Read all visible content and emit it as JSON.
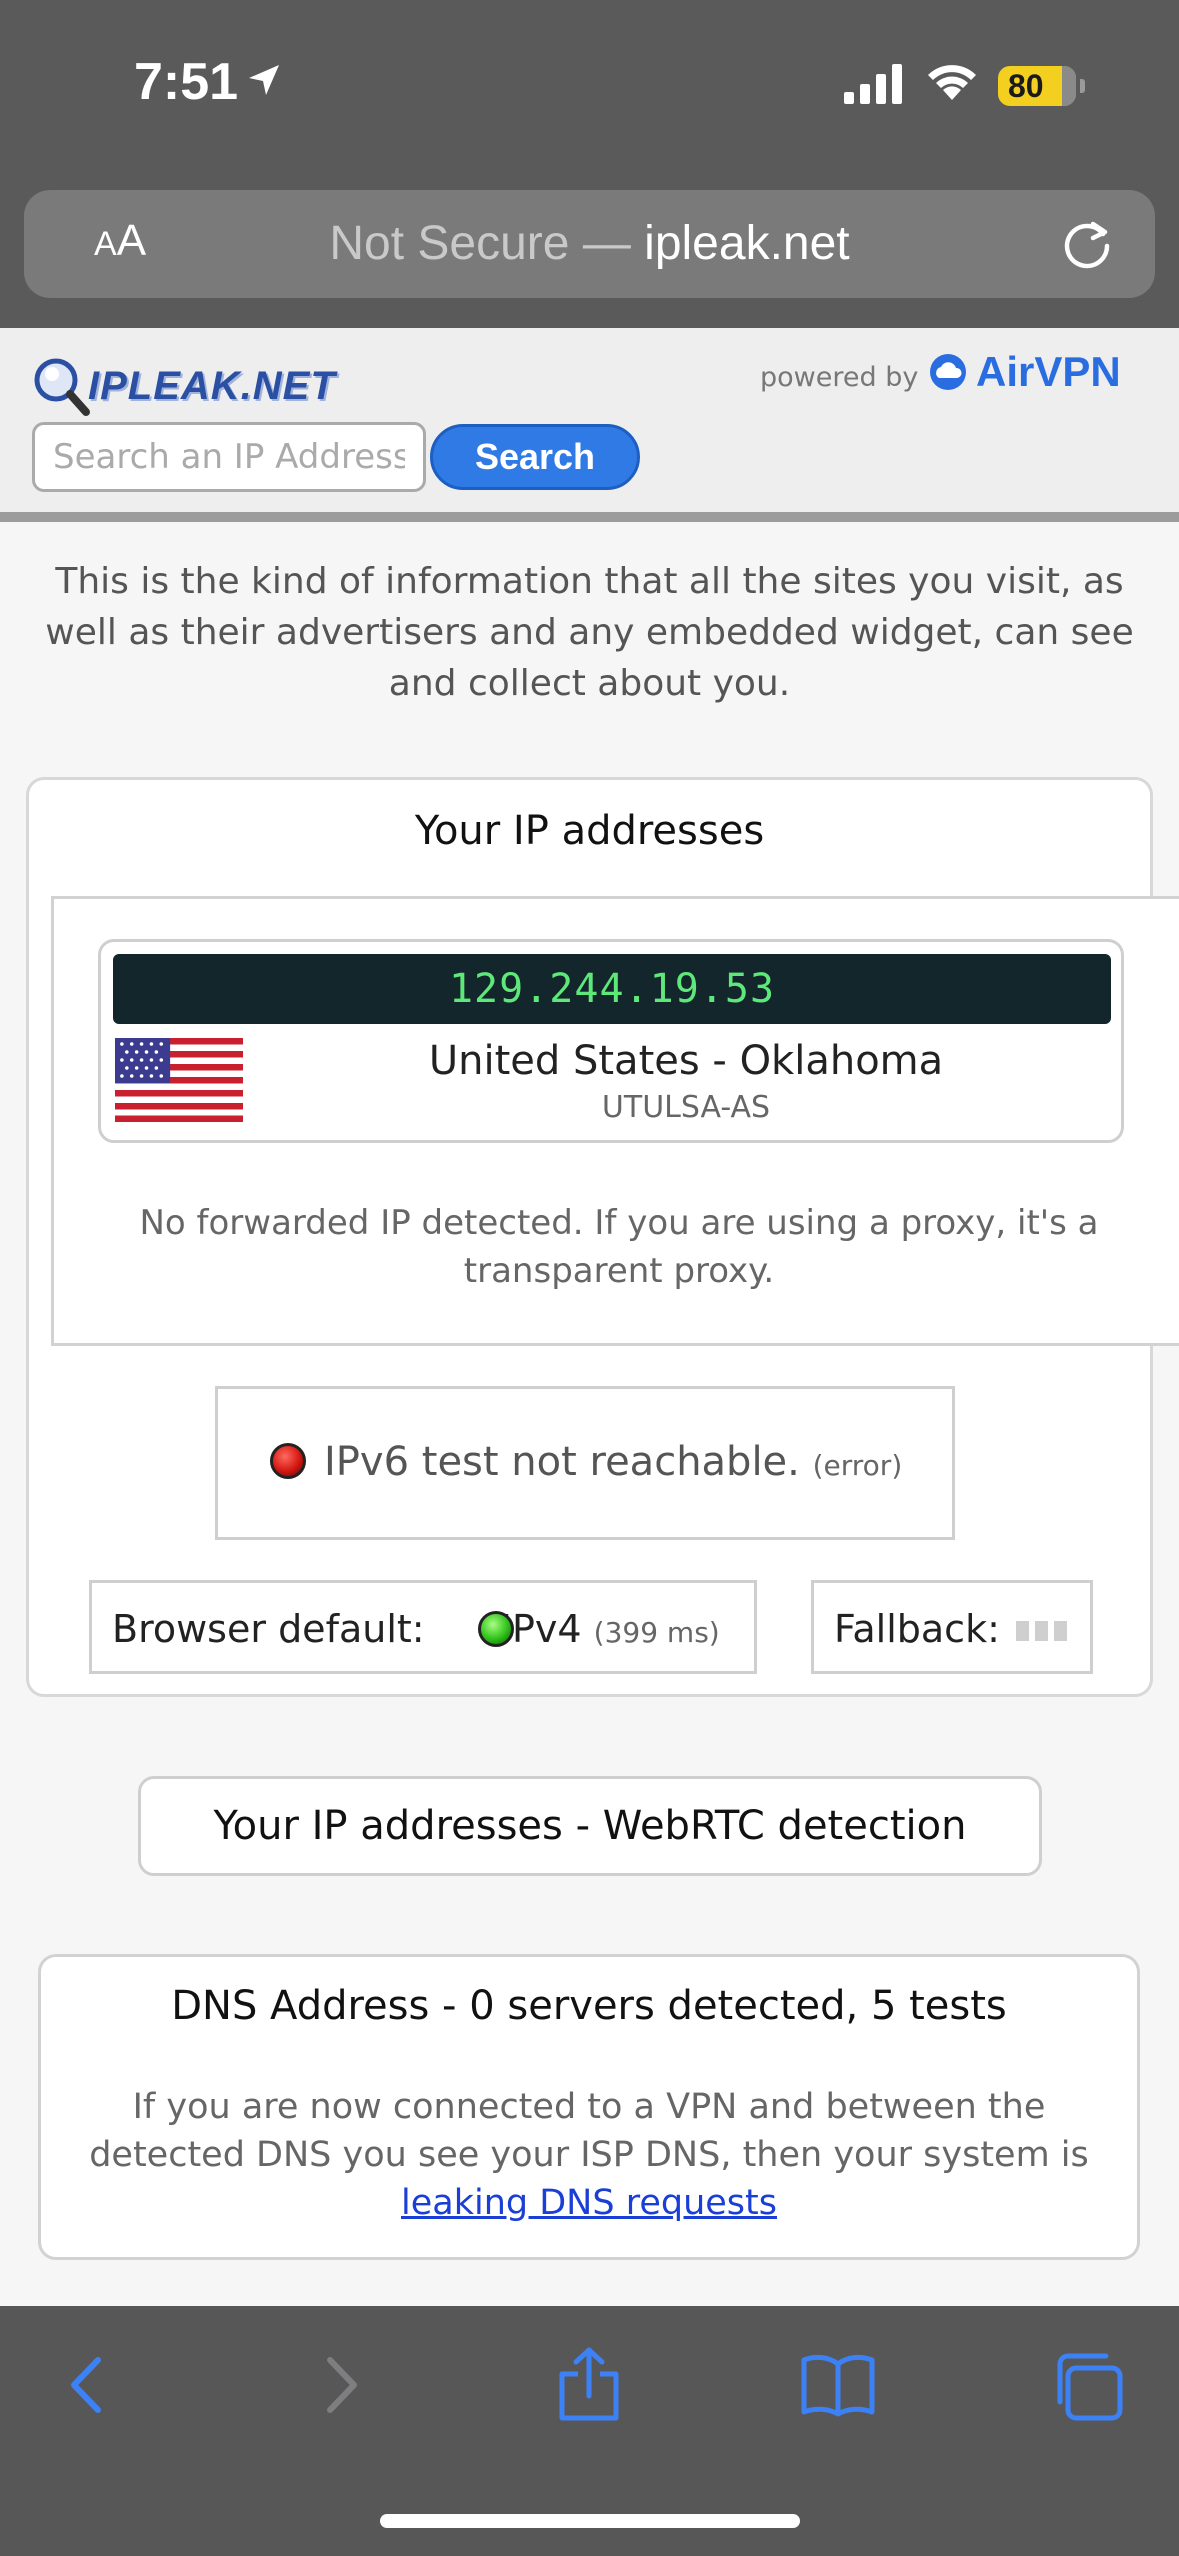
{
  "status_bar": {
    "time": "7:51",
    "battery": "80"
  },
  "address_bar": {
    "text_size_small": "A",
    "text_size_big": "A",
    "not_secure": "Not Secure —",
    "host": "ipleak.net"
  },
  "header": {
    "logo": "IPLEAK.NET",
    "powered_by": "powered by",
    "brand": "AirVPN",
    "search_placeholder": "Search an IP Address",
    "search_button": "Search"
  },
  "intro": "This is the kind of information that all the sites you visit, as well as their advertisers and any embedded widget, can see and collect about you.",
  "ip_section": {
    "title": "Your IP addresses",
    "ip": "129.244.19.53",
    "location": "United States - Oklahoma",
    "isp": "UTULSA-AS",
    "forwarded_note": "No forwarded IP detected. If you are using a proxy, it's a transparent proxy.",
    "ipv6_status": "IPv6 test not reachable.",
    "ipv6_error": "(error)",
    "browser_default_label": "Browser default:",
    "browser_default_value": "IPv4",
    "browser_default_time": "(399 ms)",
    "fallback_label": "Fallback:"
  },
  "webrtc_button": "Your IP addresses - WebRTC detection",
  "dns_section": {
    "title": "DNS Address - 0 servers detected, 5 tests",
    "text": "If you are now connected to a VPN and between the detected DNS you see your ISP DNS, then your system is",
    "link": "leaking DNS requests"
  },
  "toolbar": {
    "icons": [
      "back-icon",
      "forward-icon",
      "share-icon",
      "bookmarks-icon",
      "tabs-icon"
    ]
  },
  "colors": {
    "accent": "#2f7ae5",
    "ip_text": "#5ee87a",
    "ip_background": "#13262b",
    "link": "#1a3fd6"
  }
}
